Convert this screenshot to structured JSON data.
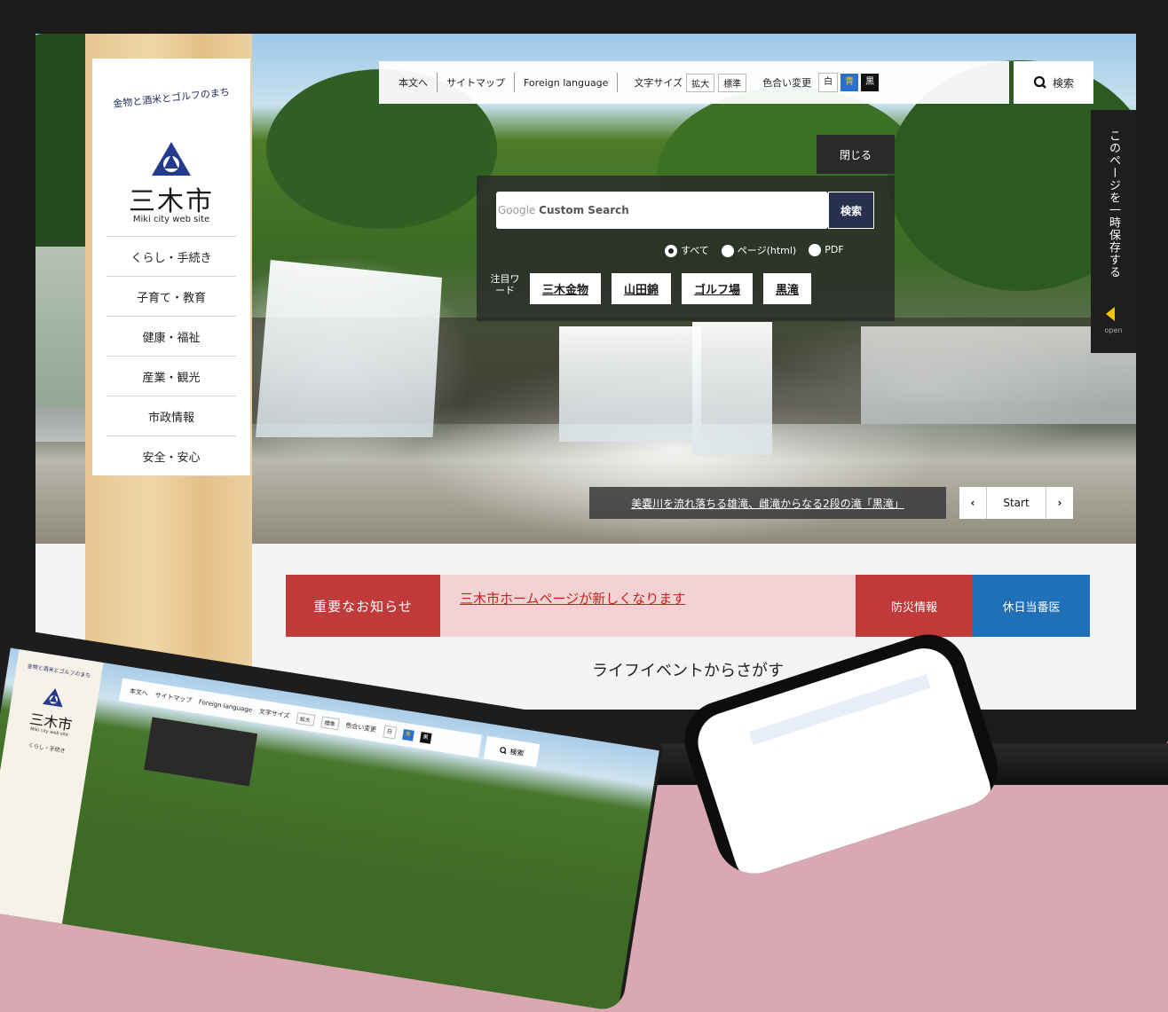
{
  "site": {
    "motto": "金物と酒米とゴルフのまち",
    "city_name": "三木市",
    "city_sub": "Miki city web site",
    "nav": [
      "くらし・手続き",
      "子育て・教育",
      "健康・福祉",
      "産業・観光",
      "市政情報",
      "安全・安心"
    ]
  },
  "toolbar": {
    "skip": "本文へ",
    "sitemap": "サイトマップ",
    "foreign": "Foreign language",
    "font_size_label": "文字サイズ",
    "font_large": "拡大",
    "font_standard": "標準",
    "color_label": "色合い変更",
    "color_white": "白",
    "color_blue": "青",
    "color_black": "黒",
    "search": "検索"
  },
  "side_tab": {
    "label": "このページを一時保存する",
    "open": "open"
  },
  "search_panel": {
    "close": "閉じる",
    "google": "Google",
    "custom_search": "Custom Search",
    "button": "検索",
    "radios": [
      "すべて",
      "ページ(html)",
      "PDF"
    ],
    "keyword_label": "注目ワード",
    "keywords": [
      "三木金物",
      "山田錦",
      "ゴルフ場",
      "黒滝"
    ]
  },
  "slider": {
    "caption": "美嚢川を流れ落ちる雄滝、雌滝からなる2段の滝「黒滝」",
    "prev": "‹",
    "start": "Start",
    "next": "›"
  },
  "notice": {
    "label": "重要なお知らせ",
    "text": "三木市ホームページが新しくなります",
    "bousai": "防災情報",
    "kyujitsu": "休日当番医"
  },
  "life_events": {
    "title": "ライフイベントからさがす"
  },
  "tablet": {
    "motto": "金物と酒米とゴルフのまち",
    "city_name": "三木市",
    "city_sub": "Miki city web site",
    "nav_first": "くらし・手続き",
    "skip": "本文へ",
    "sitemap": "サイトマップ",
    "foreign": "Foreign language",
    "font_size_label": "文字サイズ",
    "font_large": "拡大",
    "font_standard": "標準",
    "color_label": "色合い変更",
    "color_white": "白",
    "color_blue": "青",
    "color_black": "黒",
    "search": "検索"
  },
  "colors": {
    "accent_red": "#c13a3a",
    "accent_blue": "#1f6fb9",
    "notice_pink": "#f3d2d4",
    "navy": "#27304f"
  }
}
